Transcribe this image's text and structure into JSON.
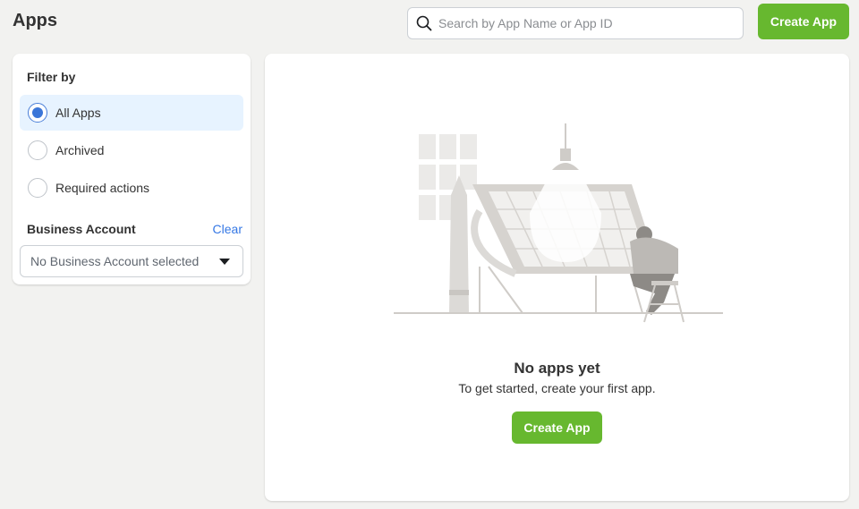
{
  "header": {
    "title": "Apps",
    "search_placeholder": "Search by App Name or App ID",
    "search_value": "",
    "create_label": "Create App"
  },
  "filter": {
    "title": "Filter by",
    "options": [
      {
        "label": "All Apps",
        "selected": true
      },
      {
        "label": "Archived",
        "selected": false
      },
      {
        "label": "Required actions",
        "selected": false
      }
    ],
    "business_account": {
      "title": "Business Account",
      "clear_label": "Clear",
      "selected_value": "No Business Account selected"
    }
  },
  "empty_state": {
    "title": "No apps yet",
    "subtitle": "To get started, create your first app.",
    "create_label": "Create App"
  },
  "colors": {
    "accent_green": "#67b82f",
    "link_blue": "#3578e5",
    "radio_blue": "#3b76d8",
    "selected_bg": "#e7f3ff",
    "page_bg": "#f2f2f0"
  },
  "icons": {
    "search": "search-icon",
    "dropdown": "caret-down-icon",
    "illustration": "empty-state-illustration"
  }
}
